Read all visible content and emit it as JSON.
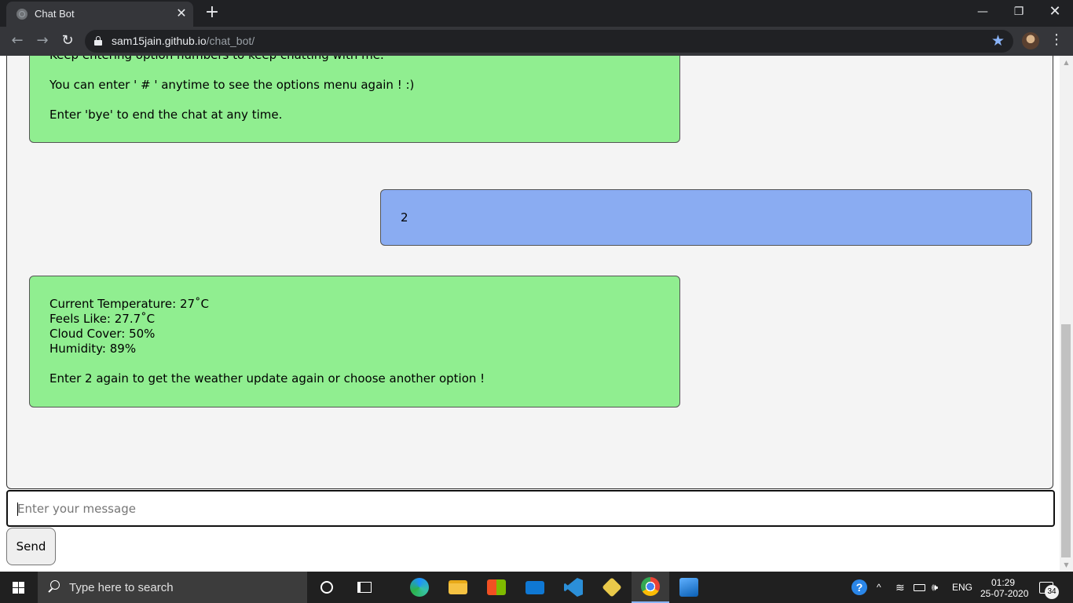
{
  "browser": {
    "tab_title": "Chat Bot",
    "url_host": "sam15jain.github.io",
    "url_path": "/chat_bot/",
    "new_tab": "+",
    "close_tab": "✕",
    "minimize": "—",
    "maximize": "❐",
    "close_window": "✕"
  },
  "chat": {
    "messages": [
      {
        "sender": "bot",
        "lines": [
          "Keep entering option numbers to keep chatting with me.",
          "You can enter ' # ' anytime to see the options menu again ! :)",
          "Enter 'bye' to end the chat at any time."
        ]
      },
      {
        "sender": "user",
        "lines": [
          "2"
        ]
      },
      {
        "sender": "bot",
        "lines": [
          "Current Temperature: 27˚C",
          "Feels Like: 27.7˚C",
          "Cloud Cover: 50%",
          "Humidity: 89%",
          "Enter 2 again to get the weather update again or choose another option !"
        ]
      }
    ],
    "input_placeholder": "Enter your message",
    "send_label": "Send"
  },
  "taskbar": {
    "search_placeholder": "Type here to search",
    "language": "ENG",
    "time": "01:29",
    "date": "25-07-2020",
    "notifications": "34"
  },
  "colors": {
    "bot_bubble": "#90ee90",
    "user_bubble": "#8aacf2",
    "chat_background": "#f4f4f4"
  }
}
